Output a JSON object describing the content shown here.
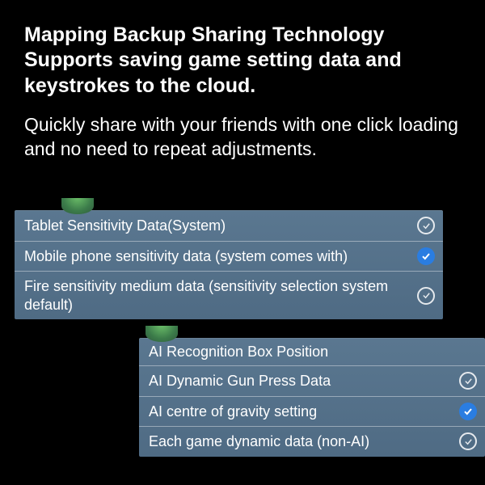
{
  "headline": "Mapping Backup Sharing Technology Supports saving game setting data and keystrokes to the cloud.",
  "subhead": "Quickly share with your friends with one click loading and no need to repeat adjustments.",
  "panel_top": {
    "rows": [
      {
        "label": "Tablet Sensitivity Data(System)",
        "selected": false
      },
      {
        "label": "Mobile phone sensitivity data (system comes with)",
        "selected": true
      },
      {
        "label": "Fire sensitivity medium data (sensitivity selection system default)",
        "selected": false
      }
    ]
  },
  "panel_bottom": {
    "header": "AI Recognition Box Position",
    "rows": [
      {
        "label": "AI Dynamic Gun Press Data",
        "selected": false
      },
      {
        "label": "AI centre of gravity setting",
        "selected": true
      },
      {
        "label": "Each game dynamic data (non-AI)",
        "selected": false
      }
    ]
  }
}
